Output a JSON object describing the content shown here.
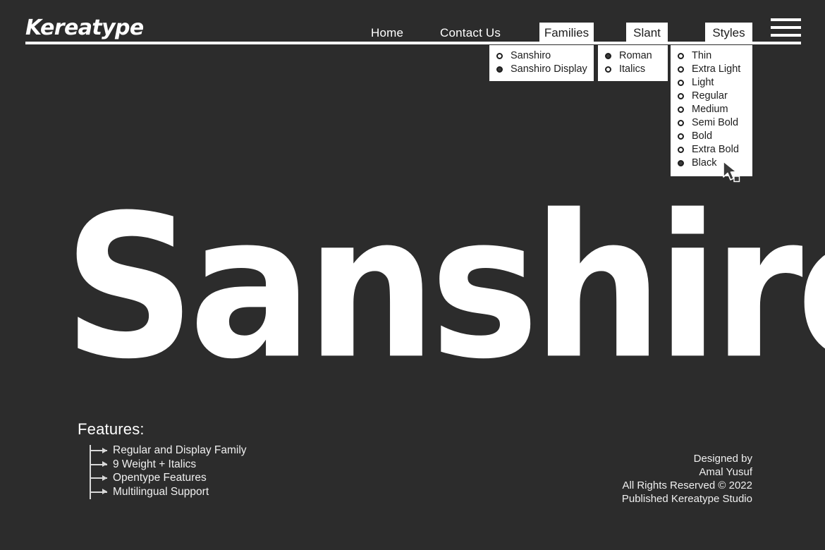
{
  "colors": {
    "background": "#2c2c2c",
    "foreground": "#ffffff",
    "panel_bg": "#ffffff",
    "panel_text": "#1d1d1d"
  },
  "header": {
    "brand": "Kereatype",
    "nav_links": [
      {
        "label": "Home"
      },
      {
        "label": "Contact Us"
      }
    ],
    "nav_tabs": [
      {
        "label": "Families"
      },
      {
        "label": "Slant"
      },
      {
        "label": "Styles"
      }
    ],
    "menu_icon": "hamburger-icon"
  },
  "panels": {
    "families": {
      "options": [
        {
          "label": "Sanshiro",
          "selected": false
        },
        {
          "label": "Sanshiro Display",
          "selected": true
        }
      ]
    },
    "slant": {
      "options": [
        {
          "label": "Roman",
          "selected": true
        },
        {
          "label": "Italics",
          "selected": false
        }
      ]
    },
    "styles": {
      "options": [
        {
          "label": "Thin",
          "selected": false
        },
        {
          "label": "Extra Light",
          "selected": false
        },
        {
          "label": "Light",
          "selected": false
        },
        {
          "label": "Regular",
          "selected": false
        },
        {
          "label": "Medium",
          "selected": false
        },
        {
          "label": "Semi Bold",
          "selected": false
        },
        {
          "label": "Bold",
          "selected": false
        },
        {
          "label": "Extra Bold",
          "selected": false
        },
        {
          "label": "Black",
          "selected": true
        }
      ]
    }
  },
  "cursor": {
    "icon": "mouse-pointer-icon"
  },
  "main": {
    "headline": "Sanshiro"
  },
  "features": {
    "title": "Features:",
    "items": [
      {
        "label": "Regular and Display Family"
      },
      {
        "label": "9 Weight + Italics"
      },
      {
        "label": "Opentype Features"
      },
      {
        "label": "Multilingual Support"
      }
    ]
  },
  "footer": {
    "lines": [
      {
        "text": "Designed by"
      },
      {
        "text": "Amal Yusuf"
      },
      {
        "text": "All Rights Reserved © 2022"
      },
      {
        "text": "Published Kereatype Studio"
      }
    ]
  }
}
